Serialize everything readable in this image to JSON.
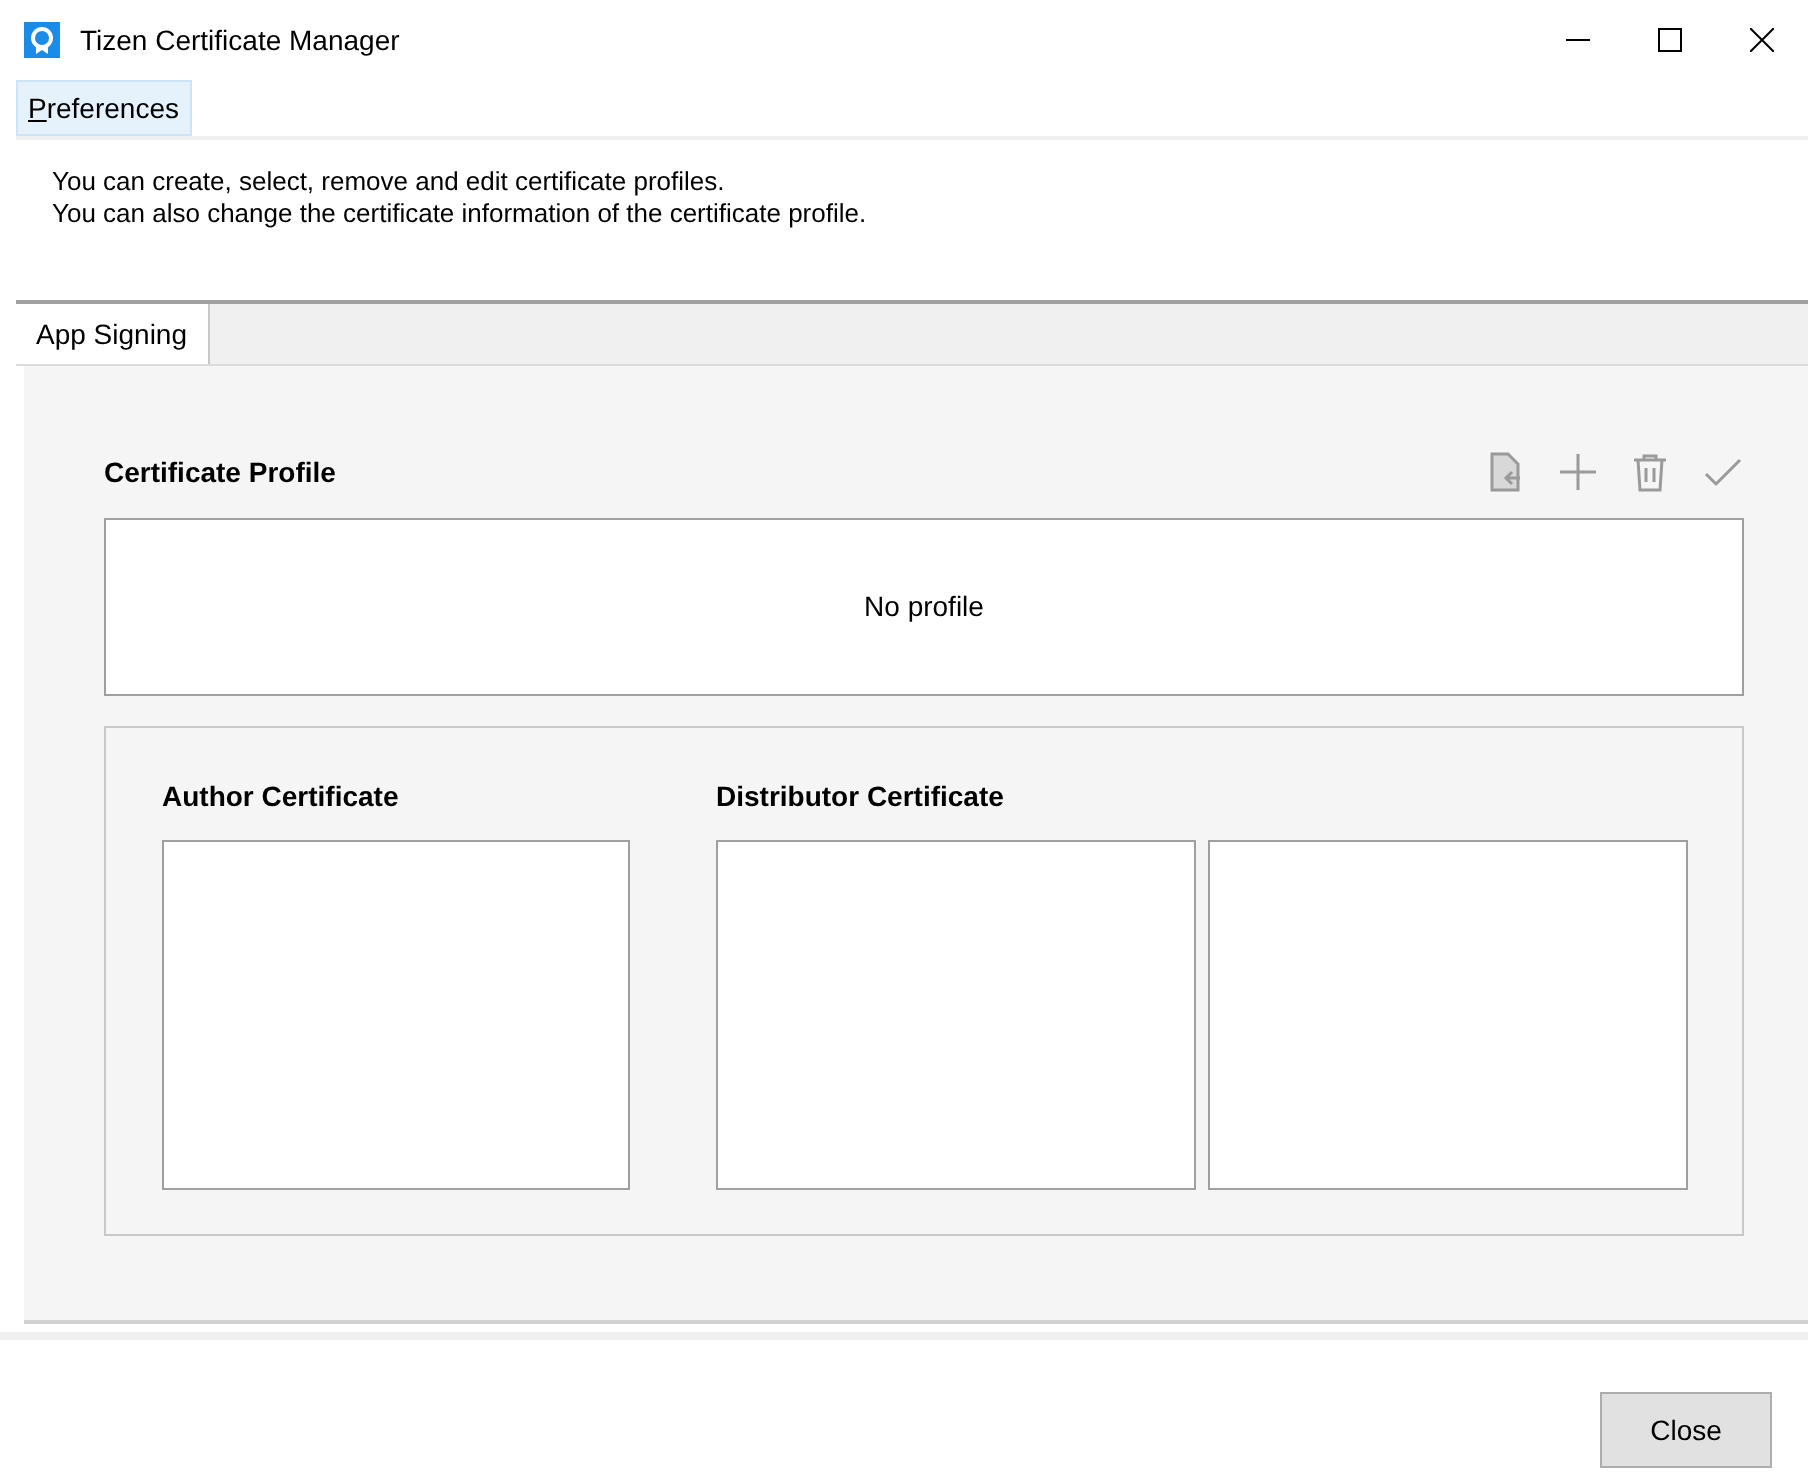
{
  "window": {
    "title": "Tizen Certificate Manager"
  },
  "menu": [
    {
      "label": "Preferences",
      "selected": true
    }
  ],
  "description": [
    "You can create, select, remove and edit certificate profiles.",
    "You can also change the certificate information of the certificate profile."
  ],
  "tabs": [
    {
      "label": "App Signing",
      "selected": true
    }
  ],
  "profile": {
    "title": "Certificate Profile",
    "empty_text": "No profile"
  },
  "toolbar": [
    {
      "kind": "import",
      "disabled": true
    },
    {
      "kind": "add",
      "disabled": true
    },
    {
      "kind": "delete",
      "disabled": true
    },
    {
      "kind": "check",
      "disabled": true
    }
  ],
  "author": {
    "title": "Author Certificate"
  },
  "distributor": {
    "title": "Distributor Certificate"
  },
  "buttons": [
    {
      "label": "Close"
    }
  ]
}
